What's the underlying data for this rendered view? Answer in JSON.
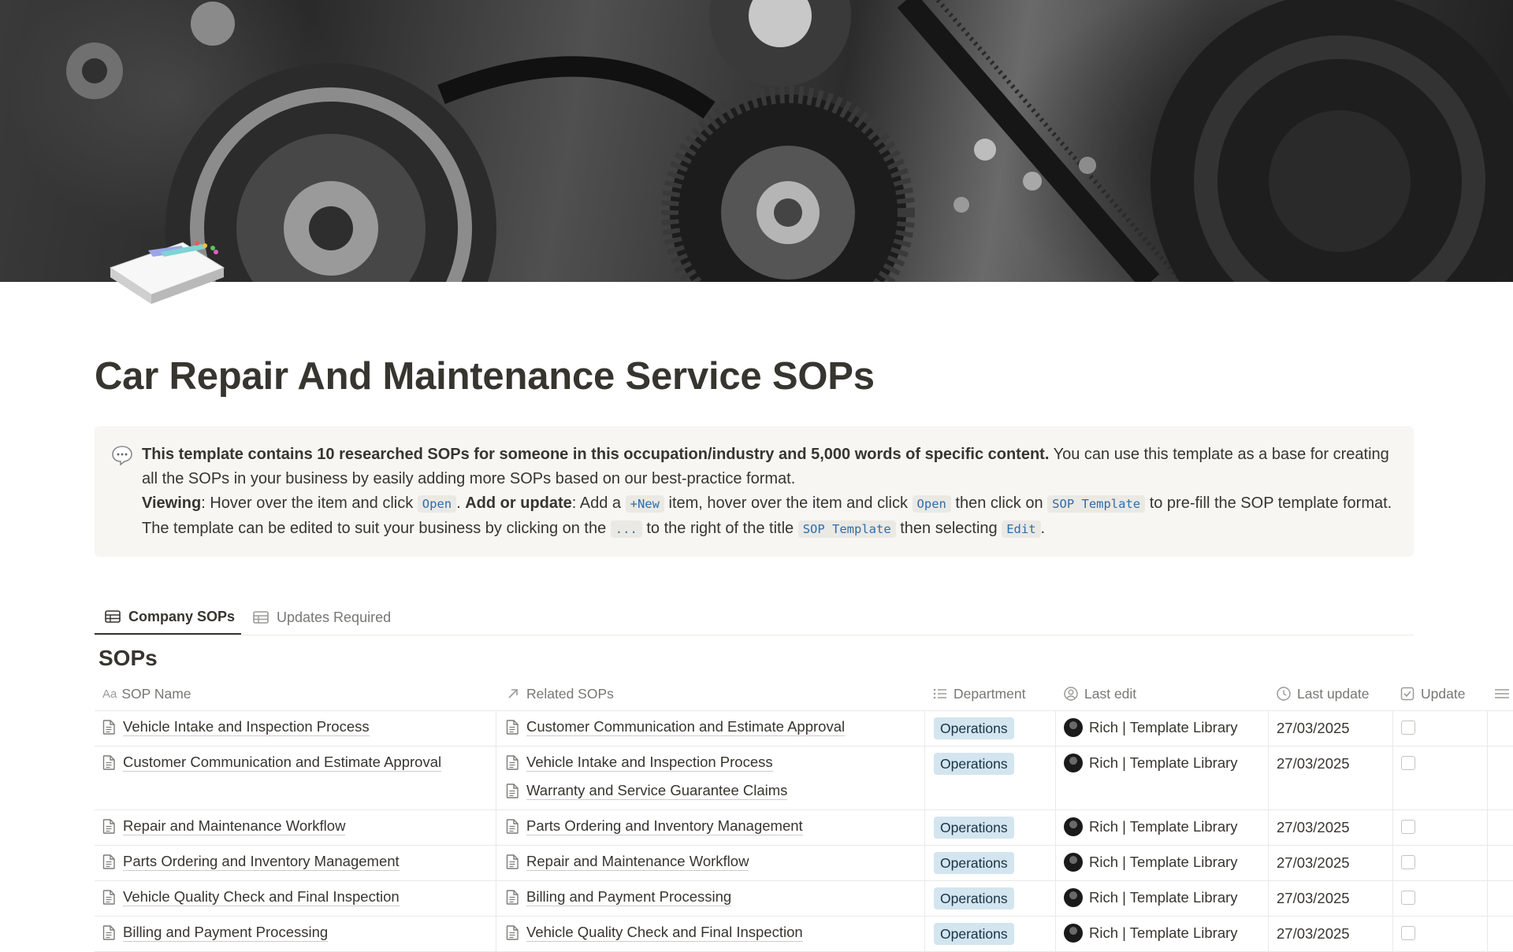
{
  "page": {
    "title": "Car Repair And Maintenance Service SOPs",
    "cover_image": "car-engine-belts-and-pulleys-photo",
    "page_icon": "stacked-documents-icon"
  },
  "callout": {
    "icon": "speech-bubble-icon",
    "bold_intro": "This template contains 10 researched SOPs for someone in this occupation/industry and 5,000 words of specific content.",
    "intro_rest": " You can use this template as a base for creating all the SOPs in your business by easily adding more SOPs based on our best-practice format.",
    "viewing_label": "Viewing",
    "viewing_text": ": Hover over the item and click ",
    "code_open": "Open",
    "add_label": "Add or update",
    "add_text_1": ": Add a ",
    "code_new": "+New",
    "add_text_2": " item, hover over the item and click ",
    "add_text_3": " then click on ",
    "code_sop_template": "SOP Template",
    "add_text_4": " to pre-fill the SOP template format. The template can be edited to suit your business by clicking on the ",
    "code_dots": "...",
    "add_text_5": " to the right of the title ",
    "add_text_6": " then selecting ",
    "code_edit": "Edit",
    "add_text_7": "."
  },
  "tabs": [
    {
      "label": "Company SOPs",
      "icon": "table-icon",
      "active": true
    },
    {
      "label": "Updates Required",
      "icon": "table-icon",
      "active": false
    }
  ],
  "database": {
    "title": "SOPs",
    "columns": [
      {
        "label": "SOP Name",
        "icon": "text-property-icon"
      },
      {
        "label": "Related SOPs",
        "icon": "relation-arrow-icon"
      },
      {
        "label": "Department",
        "icon": "list-icon"
      },
      {
        "label": "Last edit",
        "icon": "person-icon"
      },
      {
        "label": "Last update",
        "icon": "clock-icon"
      },
      {
        "label": "Update",
        "icon": "checkbox-icon"
      }
    ],
    "rows": [
      {
        "name": "Vehicle Intake and Inspection Process",
        "related": [
          "Customer Communication and Estimate Approval"
        ],
        "department": "Operations",
        "last_edit": "Rich | Template Library",
        "last_update": "27/03/2025",
        "update": false
      },
      {
        "name": "Customer Communication and Estimate Approval",
        "related": [
          "Vehicle Intake and Inspection Process",
          "Warranty and Service Guarantee Claims"
        ],
        "department": "Operations",
        "last_edit": "Rich | Template Library",
        "last_update": "27/03/2025",
        "update": false
      },
      {
        "name": "Repair and Maintenance Workflow",
        "related": [
          "Parts Ordering and Inventory Management"
        ],
        "department": "Operations",
        "last_edit": "Rich | Template Library",
        "last_update": "27/03/2025",
        "update": false
      },
      {
        "name": "Parts Ordering and Inventory Management",
        "related": [
          "Repair and Maintenance Workflow"
        ],
        "department": "Operations",
        "last_edit": "Rich | Template Library",
        "last_update": "27/03/2025",
        "update": false
      },
      {
        "name": "Vehicle Quality Check and Final Inspection",
        "related": [
          "Billing and Payment Processing"
        ],
        "department": "Operations",
        "last_edit": "Rich | Template Library",
        "last_update": "27/03/2025",
        "update": false
      },
      {
        "name": "Billing and Payment Processing",
        "related": [
          "Vehicle Quality Check and Final Inspection"
        ],
        "department": "Operations",
        "last_edit": "Rich | Template Library",
        "last_update": "27/03/2025",
        "update": false
      }
    ]
  },
  "colors": {
    "tag_operations_bg": "#d3e5ef",
    "tag_operations_text": "#183347",
    "code_text": "#2e6dab",
    "callout_bg": "#f7f6f3"
  }
}
